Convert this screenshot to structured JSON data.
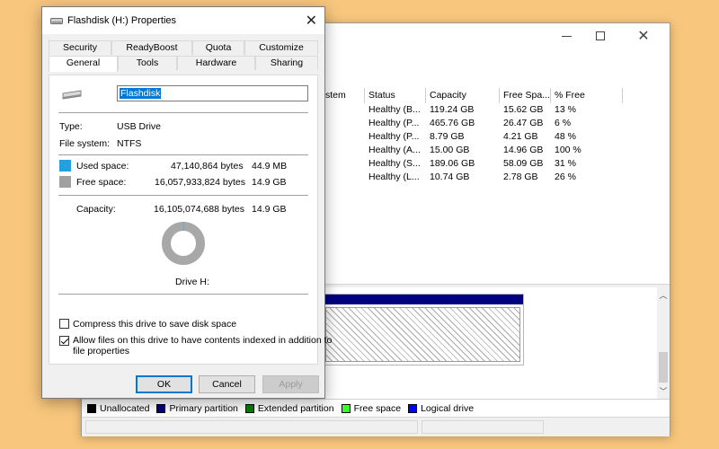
{
  "disk_management": {
    "columns": [
      "stem",
      "Status",
      "Capacity",
      "Free Spa...",
      "% Free"
    ],
    "rows": [
      {
        "status": "Healthy (B...",
        "capacity": "119.24 GB",
        "free": "15.62 GB",
        "pct": "13 %"
      },
      {
        "status": "Healthy (P...",
        "capacity": "465.76 GB",
        "free": "26.47 GB",
        "pct": "6 %"
      },
      {
        "status": "Healthy (P...",
        "capacity": "8.79 GB",
        "free": "4.21 GB",
        "pct": "48 %"
      },
      {
        "status": "Healthy (A...",
        "capacity": "15.00 GB",
        "free": "14.96 GB",
        "pct": "100 %"
      },
      {
        "status": "Healthy (S...",
        "capacity": "189.06 GB",
        "free": "58.09 GB",
        "pct": "31 %"
      },
      {
        "status": "Healthy (L...",
        "capacity": "10.74 GB",
        "free": "2.78 GB",
        "pct": "26 %"
      }
    ],
    "legend": [
      {
        "label": "Unallocated",
        "color": "#000000"
      },
      {
        "label": "Primary partition",
        "color": "#000080"
      },
      {
        "label": "Extended partition",
        "color": "#008000"
      },
      {
        "label": "Free space",
        "color": "#33ff33"
      },
      {
        "label": "Logical drive",
        "color": "#0000ff"
      }
    ]
  },
  "dialog": {
    "title": "Flashdisk (H:) Properties",
    "tabs_top": [
      "Security",
      "ReadyBoost",
      "Quota",
      "Customize"
    ],
    "tabs_bottom": [
      "General",
      "Tools",
      "Hardware",
      "Sharing"
    ],
    "active_tab": "General",
    "name_value": "Flashdisk",
    "type_label": "Type:",
    "type_value": "USB Drive",
    "fs_label": "File system:",
    "fs_value": "NTFS",
    "used_label": "Used space:",
    "used_bytes": "47,140,864 bytes",
    "used_size": "44.9 MB",
    "used_color": "#26a0da",
    "free_label": "Free space:",
    "free_bytes": "16,057,933,824 bytes",
    "free_size": "14.9 GB",
    "free_color": "#a0a0a0",
    "capacity_label": "Capacity:",
    "capacity_bytes": "16,105,074,688 bytes",
    "capacity_size": "14.9 GB",
    "used_fraction": 0.0029,
    "drive_label": "Drive H:",
    "compress_label": "Compress this drive to save disk space",
    "compress_checked": false,
    "index_label_line1": "Allow files on this drive to have contents indexed in addition to",
    "index_label_line2": "file properties",
    "index_checked": true,
    "ok_label": "OK",
    "cancel_label": "Cancel",
    "apply_label": "Apply"
  }
}
